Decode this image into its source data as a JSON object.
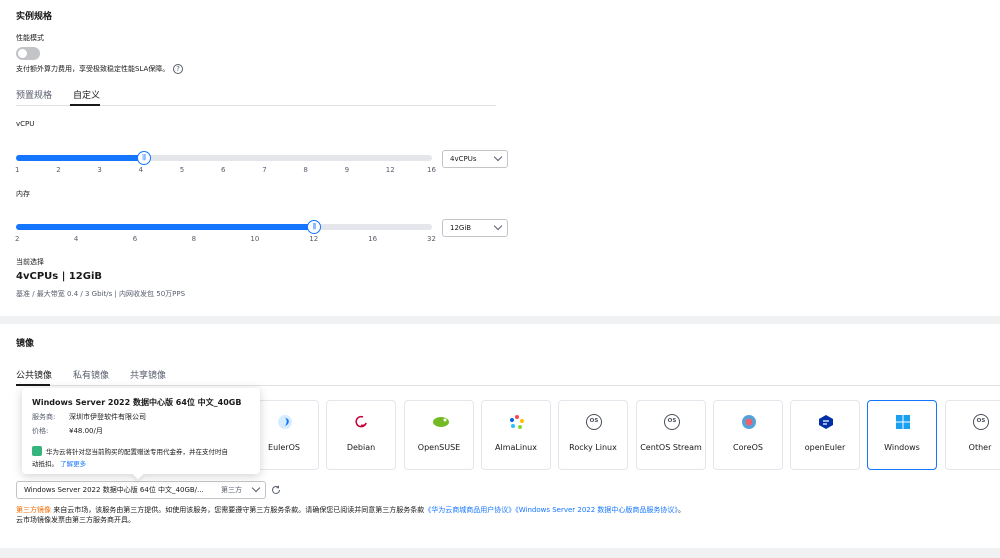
{
  "spec": {
    "title": "实例规格",
    "perf_mode_label": "性能模式",
    "perf_mode_desc": "支付额外算力费用，享受极致稳定性能SLA保障。",
    "help_icon": "?",
    "tabs": [
      {
        "label": "预置规格"
      },
      {
        "label": "自定义"
      }
    ],
    "active_tab": 1,
    "vcpu": {
      "label": "vCPU",
      "ticks": [
        "1",
        "2",
        "3",
        "4",
        "5",
        "6",
        "7",
        "8",
        "9",
        "12",
        "16"
      ],
      "selected_index": 3,
      "select_value": "4vCPUs"
    },
    "memory": {
      "label": "内存",
      "ticks": [
        "2",
        "4",
        "6",
        "8",
        "10",
        "12",
        "16",
        "32"
      ],
      "selected_index": 5,
      "select_value": "12GiB"
    },
    "current": {
      "label": "当前选择",
      "value": "4vCPUs | 12GiB",
      "detail": "基准 / 最大带宽  0.4 / 3 Gbit/s  |  内网收发包  50万PPS"
    },
    "thumb_glyph": "|||"
  },
  "image": {
    "title": "镜像",
    "tabs": [
      {
        "label": "公共镜像"
      },
      {
        "label": "私有镜像"
      },
      {
        "label": "共享镜像"
      }
    ],
    "active_tab": 0,
    "os_list": [
      {
        "name": "EulerOS",
        "icon": "euleros-icon"
      },
      {
        "name": "Debian",
        "icon": "debian-icon"
      },
      {
        "name": "OpenSUSE",
        "icon": "opensuse-icon"
      },
      {
        "name": "AlmaLinux",
        "icon": "almalinux-icon"
      },
      {
        "name": "Rocky Linux",
        "icon": "rocky-linux-icon",
        "glyph": "OS"
      },
      {
        "name": "CentOS Stream",
        "icon": "centos-stream-icon",
        "glyph": "OS"
      },
      {
        "name": "CoreOS",
        "icon": "coreos-icon"
      },
      {
        "name": "openEuler",
        "icon": "openeuler-icon"
      },
      {
        "name": "Windows",
        "icon": "windows-icon"
      },
      {
        "name": "Other",
        "icon": "other-os-icon",
        "glyph": "OS"
      }
    ],
    "selected_os": "Windows",
    "popup": {
      "title": "Windows Server 2022 数据中心版 64位 中文_40GB",
      "vendor_label": "服务商:",
      "vendor_value": "深圳市伊登软件有限公司",
      "price_label": "价格:",
      "price_value": "¥48.00/月",
      "coupon_text": "华为云将针对您当前购买的配置赠送专用代金券，并在支付时自",
      "coupon_text2": "动抵扣。",
      "learn_more": "了解更多"
    },
    "select": {
      "value": "Windows Server 2022 数据中心版 64位 中文_40GB/...",
      "tag": "第三方"
    },
    "notice": {
      "prefix": "第三方镜像",
      "text1": " 来自云市场，该服务由第三方提供。如使用该服务，您需要遵守第三方服务条款。请确保您已阅读并同意第三方服务条款",
      "link1": "《华为云商城商品用户协议》",
      "link2": "《Windows Server 2022 数据中心版商品服务协议》",
      "text2": "。",
      "line2": "云市场镜像发票由第三方服务商开具。"
    }
  },
  "colors": {
    "accent": "#1476ff",
    "orange": "#ee6a00"
  }
}
